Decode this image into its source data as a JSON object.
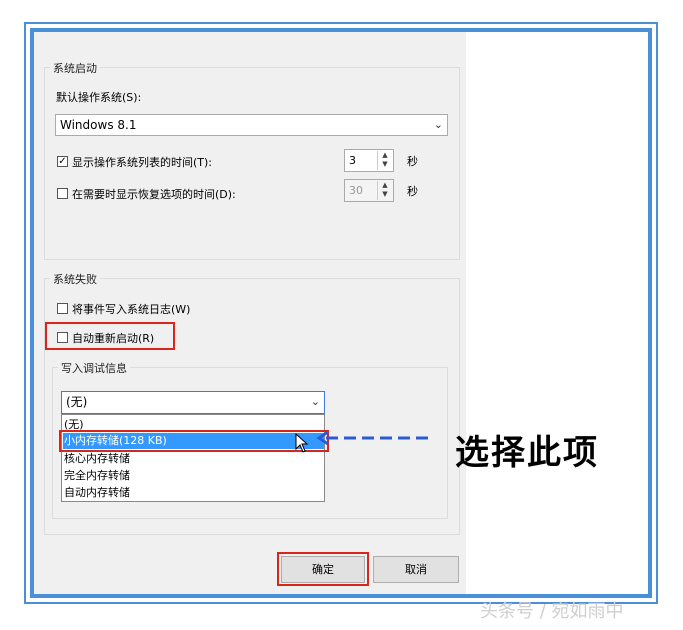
{
  "startup": {
    "group_title": "系统启动",
    "default_os_label": "默认操作系统(S):",
    "default_os_value": "Windows 8.1",
    "show_list": {
      "label": "显示操作系统列表的时间(T):",
      "checked": true,
      "value": "3",
      "unit": "秒"
    },
    "show_recovery": {
      "label": "在需要时显示恢复选项的时间(D):",
      "checked": false,
      "value": "30",
      "unit": "秒"
    }
  },
  "failure": {
    "group_title": "系统失败",
    "write_event_label": "将事件写入系统日志(W)",
    "auto_restart_label": "自动重新启动(R)",
    "debug": {
      "group_title": "写入调试信息",
      "selected": "(无)",
      "options": [
        "(无)",
        "小内存转储(128 KB)",
        "核心内存转储",
        "完全内存转储",
        "自动内存转储"
      ]
    }
  },
  "buttons": {
    "ok": "确定",
    "cancel": "取消"
  },
  "annotation": {
    "text": "选择此项",
    "accent": "#2a5bd7"
  },
  "watermark": "头条号 / 宛如雨中",
  "colors": {
    "frame": "#4a90d9",
    "highlight_box": "#d9261c",
    "selection": "#3399ff"
  }
}
